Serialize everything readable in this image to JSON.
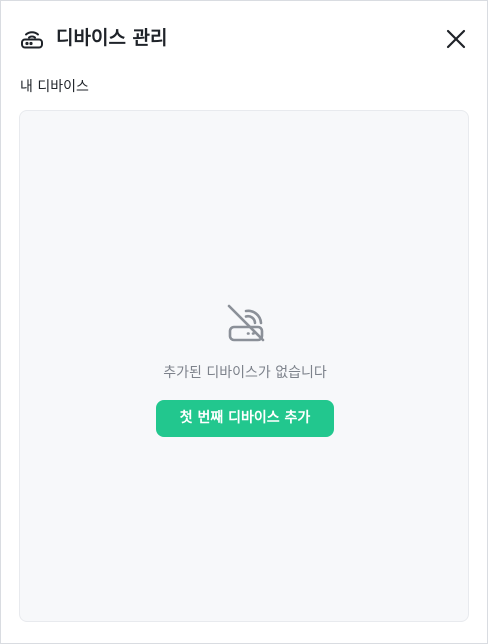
{
  "dialog": {
    "title": "디바이스 관리",
    "title_icon": "router-icon",
    "close_icon": "close-icon"
  },
  "devices_section": {
    "label": "내 디바이스",
    "empty_icon": "router-off-icon",
    "empty_message": "추가된 디바이스가 없습니다",
    "add_first_button_label": "첫 번째 디바이스 추가"
  },
  "colors": {
    "accent": "#22c78e",
    "panel_background": "#f7f8fa",
    "muted_text": "#7d828b",
    "icon_gray": "#8b9098"
  }
}
